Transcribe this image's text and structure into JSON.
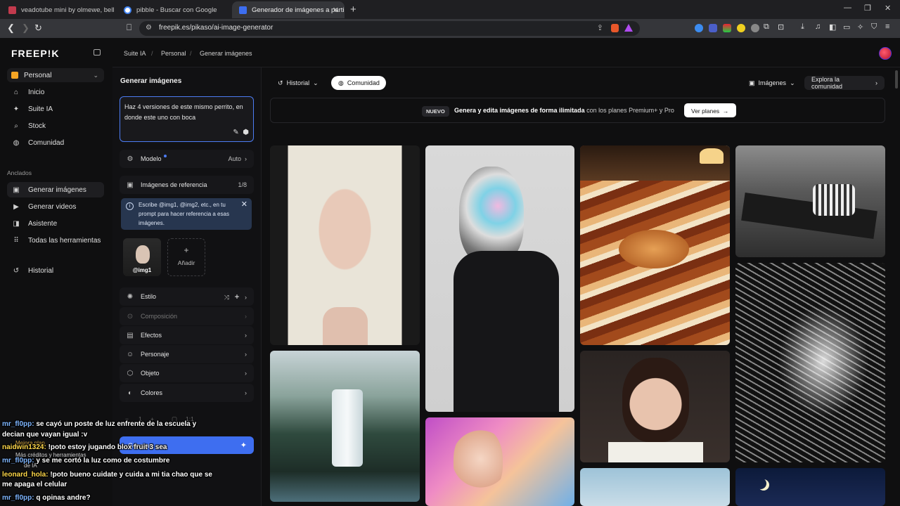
{
  "browser": {
    "tabs": [
      {
        "title": "veadotube mini by olmewe, bella!",
        "color": "#c23a4d"
      },
      {
        "title": "pibble - Buscar con Google",
        "color": "#4285f4"
      },
      {
        "title": "Generador de imágenes a partir",
        "color": "#3d6ef0"
      }
    ],
    "url": "freepik.es/pikaso/ai-image-generator",
    "new_tab": "+",
    "minimize": "—",
    "maximize": "❐",
    "close": "✕"
  },
  "sidebar": {
    "logo": "FREEP!K",
    "workspace": "Personal",
    "items": [
      {
        "label": "Inicio",
        "icon": "⌂"
      },
      {
        "label": "Suite IA",
        "icon": "✦"
      },
      {
        "label": "Stock",
        "icon": "⌕"
      },
      {
        "label": "Comunidad",
        "icon": "◍"
      }
    ],
    "pinned_heading": "Anclados",
    "pinned": [
      {
        "label": "Generar imágenes",
        "icon": "▣"
      },
      {
        "label": "Generar videos",
        "icon": "▶"
      },
      {
        "label": "Asistente",
        "icon": "◨"
      },
      {
        "label": "Todas las herramientas",
        "icon": "⠿"
      }
    ],
    "history": {
      "label": "Historial",
      "icon": "↺"
    }
  },
  "breadcrumb": [
    "Suite IA",
    "Personal",
    "Generar imágenes"
  ],
  "generator": {
    "title": "Generar imágenes",
    "prompt": "Haz 4 versiones de este mismo perrito, en donde este uno con boca",
    "model_label": "Modelo",
    "model_value": "Auto",
    "ref_label": "Imágenes de referencia",
    "ref_count": "1/8",
    "info": "Escribe @img1, @img2, etc., en tu prompt para hacer referencia a esas imágenes.",
    "ref_image_label": "@img1",
    "add_label": "Añadir",
    "options": [
      {
        "label": "Estilo",
        "icon": "✺"
      },
      {
        "label": "Composición",
        "icon": "⊙"
      },
      {
        "label": "Efectos",
        "icon": "▤"
      },
      {
        "label": "Personaje",
        "icon": "☺"
      },
      {
        "label": "Objeto",
        "icon": "⬡"
      },
      {
        "label": "Colores",
        "icon": "◐"
      }
    ],
    "count": "1",
    "aspect": "1:1",
    "generate_label": "Generar"
  },
  "main": {
    "history_label": "Historial",
    "community_label": "Comunidad",
    "images_label": "Imágenes",
    "explore_label": "Explora la comunidad",
    "banner_badge": "NUEVO",
    "banner_bold": "Genera y edita imágenes de forma ilimitada",
    "banner_text": " con los planes Premium+ y Pro",
    "banner_button": "Ver planes"
  },
  "overlay": {
    "ghost_text_1": "Mejora plan",
    "ghost_text_2": "Más créditos y herramientas",
    "ghost_text_3": "de IA",
    "chat": [
      {
        "user": "mr_fl0pp:",
        "text": " se cayó un poste de luz enfrente de la escuela y"
      },
      {
        "user": "",
        "text": "decian que vayan igual :v"
      },
      {
        "user": "naidwin1324:",
        "text": " !poto estoy jugando blox fruit 3 sea"
      },
      {
        "user": "mr_fl0pp:",
        "text": " y se me cortó la luz como de costumbre"
      },
      {
        "user": "leonard_hola:",
        "text": " !poto bueno cuidate y cuida a mi tia chao que se"
      },
      {
        "user": "",
        "text": "me apaga el celular"
      },
      {
        "user": "mr_fl0pp:",
        "text": " q opinas andre?"
      }
    ]
  }
}
